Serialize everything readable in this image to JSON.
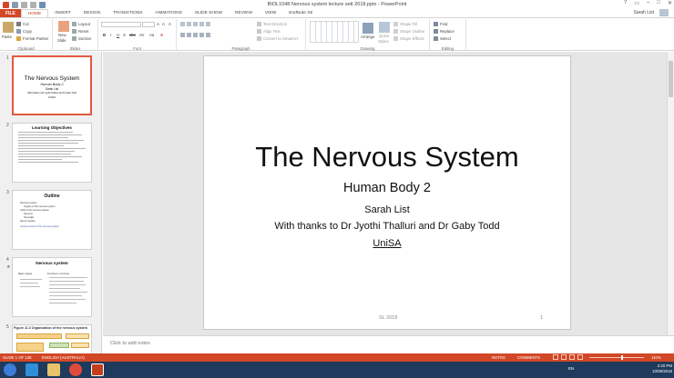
{
  "titlebar": {
    "title": "BIOL1048 Nervous system lecture sett 2018.pptx - PowerPoint",
    "help": "?",
    "restore": "▭",
    "minimize": "–",
    "maximize": "□",
    "close": "✕"
  },
  "tabs": [
    "FILE",
    "HOME",
    "INSERT",
    "DESIGN",
    "TRANSITIONS",
    "ANIMATIONS",
    "SLIDE SHOW",
    "REVIEW",
    "VIEW",
    "EndNote X8"
  ],
  "user": "Sarah List",
  "ribbon": {
    "clipboard": {
      "paste": "Paste",
      "cut": "Cut",
      "copy": "Copy",
      "format_painter": "Format Painter",
      "label": "Clipboard"
    },
    "slides": {
      "new_slide": "New",
      "new_slide2": "Slide",
      "layout": "Layout",
      "reset": "Reset",
      "section": "Section",
      "label": "Slides"
    },
    "font": {
      "bold": "B",
      "italic": "I",
      "underline": "U",
      "strike": "S",
      "shadow": "abc",
      "spacing": "AV",
      "case": "Aa",
      "grow": "A",
      "shrink": "A",
      "clear": "A",
      "color": "A",
      "label": "Font"
    },
    "paragraph": {
      "text_direction": "Text Direction",
      "align_text": "Align Text",
      "smartart": "Convert to SmartArt",
      "label": "Paragraph"
    },
    "drawing": {
      "arrange": "Arrange",
      "quick_styles": "Quick",
      "quick_styles2": "Styles",
      "shape_fill": "Shape Fill",
      "shape_outline": "Shape Outline",
      "shape_effects": "Shape Effects",
      "label": "Drawing"
    },
    "editing": {
      "find": "Find",
      "replace": "Replace",
      "select": "Select",
      "label": "Editing"
    }
  },
  "thumbnails": [
    {
      "num": "1",
      "title": "The Nervous System",
      "subtitle": "Human Body 2",
      "author": "Sarah List",
      "thanks": "With thanks to Dr Jyothi Thalluri and Dr Gaby Todd",
      "org": "UniSA"
    },
    {
      "num": "2",
      "title": "Learning Objectives"
    },
    {
      "num": "3",
      "title": "Outline",
      "lines": [
        "Nervous system",
        "Organs of the nervous system",
        "Cells of the nervous system",
        "Neurons",
        "Neuroglia",
        "Nerve impulse",
        "Central control of the nervous system"
      ]
    },
    {
      "num": "4",
      "title": "Nervous system",
      "col1": "Major organs",
      "col2": "Functions: numerous"
    },
    {
      "num": "5",
      "caption": "Figure 11.3 Organization of the nervous system"
    }
  ],
  "slide": {
    "title": "The Nervous System",
    "subtitle": "Human Body 2",
    "author": "Sarah List",
    "thanks": "With thanks to Dr Jyothi Thalluri and Dr Gaby Todd",
    "org": "UniSA",
    "footer_left": "SL 2018",
    "footer_right": "1"
  },
  "notes_placeholder": "Click to add notes",
  "status": {
    "slide_of": "SLIDE 1 OF 138",
    "language": "ENGLISH (AUSTRALIA)",
    "notes": "NOTES",
    "comments": "COMMENTS",
    "zoom": "110%"
  },
  "taskbar": {
    "lang": "EN",
    "time": "2:20 PM",
    "date": "10/08/2018"
  },
  "colors": {
    "accent": "#d24726",
    "taskbar": "#1e3a5c",
    "thumb_selected": "#e2583e"
  }
}
